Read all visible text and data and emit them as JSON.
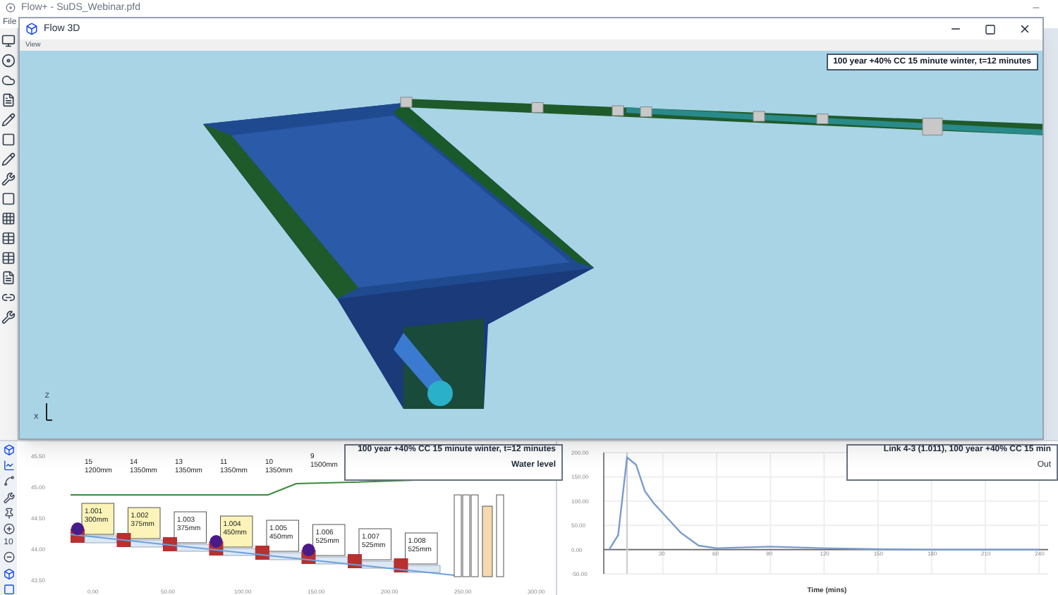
{
  "app": {
    "title": "Flow+ - SuDS_Webinar.pfd",
    "menu": [
      "File"
    ]
  },
  "window": {
    "title": "Flow 3D",
    "menu": [
      "View"
    ],
    "scene_label": "100 year +40% CC 15 minute winter, t=12 minutes",
    "axis_labels": [
      "Z",
      "X"
    ]
  },
  "toolbar": {
    "zoom": "10"
  },
  "profile": {
    "legend": {
      "title": "100 year +40% CC 15 minute winter, t=12 minutes",
      "item": "Water level"
    },
    "manholes": [
      {
        "name": "15",
        "depth": "1200mm"
      },
      {
        "name": "14",
        "depth": "1350mm"
      },
      {
        "name": "13",
        "depth": "1350mm"
      },
      {
        "name": "11",
        "depth": "1350mm"
      },
      {
        "name": "10",
        "depth": "1350mm"
      },
      {
        "name": "9",
        "depth": "1500mm"
      }
    ],
    "pipes": [
      {
        "name": "1.001",
        "size": "300mm",
        "highlighted": true
      },
      {
        "name": "1.002",
        "size": "375mm",
        "highlighted": true
      },
      {
        "name": "1.003",
        "size": "375mm",
        "highlighted": false
      },
      {
        "name": "1.004",
        "size": "450mm",
        "highlighted": true
      },
      {
        "name": "1.005",
        "size": "450mm",
        "highlighted": false
      },
      {
        "name": "1.006",
        "size": "525mm",
        "highlighted": false
      },
      {
        "name": "1.007",
        "size": "525mm",
        "highlighted": false
      },
      {
        "name": "1.008",
        "size": "525mm",
        "highlighted": false
      }
    ],
    "yticks": [
      "45.50",
      "45.00",
      "44.50",
      "44.00",
      "43.50"
    ],
    "xticks": [
      "0.00",
      "50.00",
      "100.00",
      "150.00",
      "200.00",
      "250.00",
      "300.00"
    ]
  },
  "hydrograph": {
    "legend": {
      "title": "Link 4-3 (1.011), 100 year +40% CC 15 min"
    },
    "chart_data": {
      "type": "line",
      "xlabel": "Time (mins)",
      "x": [
        0,
        5,
        10,
        15,
        20,
        25,
        30,
        40,
        50,
        60,
        90,
        120,
        150,
        180,
        210,
        240
      ],
      "series": [
        {
          "name": "Out",
          "color": "#7a9ccc",
          "values": [
            0,
            30,
            190,
            175,
            120,
            95,
            75,
            35,
            8,
            3,
            6,
            3,
            1,
            0,
            0,
            0
          ]
        }
      ],
      "grid": true,
      "ref_lines": [
        {
          "axis": "x",
          "value": 10,
          "color": "#cccccc"
        }
      ],
      "xlim": [
        -3,
        245
      ],
      "ylim": [
        -50,
        200
      ],
      "xticks": [
        30,
        60,
        90,
        120,
        150,
        180,
        210,
        240
      ],
      "yticks": [
        {
          "value": 200,
          "label": "200.00"
        },
        {
          "value": 150,
          "label": "150.00"
        },
        {
          "value": 100,
          "label": "100.00"
        },
        {
          "value": 50,
          "label": "50.00"
        },
        {
          "value": 0,
          "label": "0.00"
        },
        {
          "value": -50,
          "label": "-50.00"
        }
      ]
    }
  }
}
